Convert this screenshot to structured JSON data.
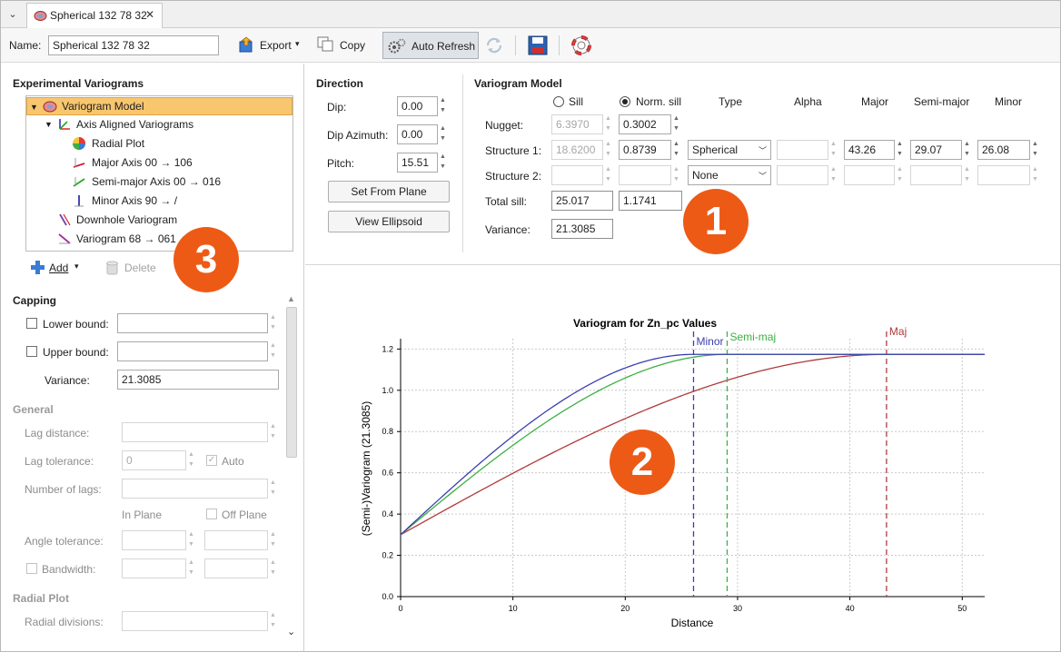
{
  "tab": {
    "title": "Spherical 132 78 32"
  },
  "toolbar": {
    "name_label": "Name:",
    "name_value": "Spherical 132 78 32",
    "export_label": "Export",
    "copy_label": "Copy",
    "auto_refresh_label": "Auto Refresh"
  },
  "experimental": {
    "heading": "Experimental Variograms",
    "tree": {
      "root": "Variogram Model",
      "aligned": "Axis Aligned Variograms",
      "radial": "Radial Plot",
      "major": "Major Axis 00 → 106",
      "semi": "Semi-major Axis 00 → 016",
      "minor": "Minor Axis 90 → /",
      "downhole": "Downhole Variogram",
      "vario68": "Variogram 68 → 061"
    },
    "add_label": "Add",
    "delete_label": "Delete"
  },
  "capping": {
    "heading": "Capping",
    "lower_label": "Lower bound:",
    "upper_label": "Upper bound:",
    "variance_label": "Variance:",
    "variance_value": "21.3085"
  },
  "general": {
    "heading": "General",
    "lag_distance": "Lag distance:",
    "lag_tolerance": "Lag tolerance:",
    "lag_tolerance_value": "0",
    "auto_label": "Auto",
    "number_of_lags": "Number of lags:",
    "in_plane": "In Plane",
    "off_plane": "Off Plane",
    "angle_tolerance": "Angle tolerance:",
    "bandwidth": "Bandwidth:"
  },
  "radial": {
    "heading": "Radial Plot",
    "divisions": "Radial divisions:"
  },
  "direction": {
    "heading": "Direction",
    "dip_label": "Dip:",
    "dip_value": "0.00",
    "dip_az_label": "Dip Azimuth:",
    "dip_az_value": "0.00",
    "pitch_label": "Pitch:",
    "pitch_value": "15.51",
    "set_from_plane": "Set From Plane",
    "view_ellipsoid": "View Ellipsoid"
  },
  "model": {
    "heading": "Variogram Model",
    "sill_label": "Sill",
    "norm_sill_label": "Norm. sill",
    "col_type": "Type",
    "col_alpha": "Alpha",
    "col_major": "Major",
    "col_semi": "Semi-major",
    "col_minor": "Minor",
    "nugget_label": "Nugget:",
    "nugget_sill": "6.3970",
    "nugget_norm": "0.3002",
    "s1_label": "Structure 1:",
    "s1_sill": "18.6200",
    "s1_norm": "0.8739",
    "s1_type": "Spherical",
    "s1_major": "43.26",
    "s1_semi": "29.07",
    "s1_minor": "26.08",
    "s2_label": "Structure 2:",
    "s2_type": "None",
    "total_label": "Total sill:",
    "total_sill": "25.017",
    "total_norm": "1.1741",
    "variance_label": "Variance:",
    "variance_value": "21.3085"
  },
  "badges": {
    "one": "1",
    "two": "2",
    "three": "3"
  },
  "chart_data": {
    "type": "line",
    "title": "Variogram for Zn_pc Values",
    "xlabel": "Distance",
    "ylabel": "(Semi-)Variogram (21.3085)",
    "xlim": [
      0,
      52
    ],
    "ylim": [
      0,
      1.25
    ],
    "xticks": [
      0,
      10,
      20,
      30,
      40,
      50
    ],
    "yticks": [
      0.0,
      0.2,
      0.4,
      0.6,
      0.8,
      1.0,
      1.2
    ],
    "grid": true,
    "nugget": 0.3002,
    "sill": 1.1741,
    "series": [
      {
        "name": "Minor",
        "range": 26.08,
        "color": "#3b3fae"
      },
      {
        "name": "Semi-maj",
        "range": 29.07,
        "color": "#3cb043"
      },
      {
        "name": "Maj",
        "range": 43.26,
        "color": "#b03a3a"
      }
    ]
  }
}
